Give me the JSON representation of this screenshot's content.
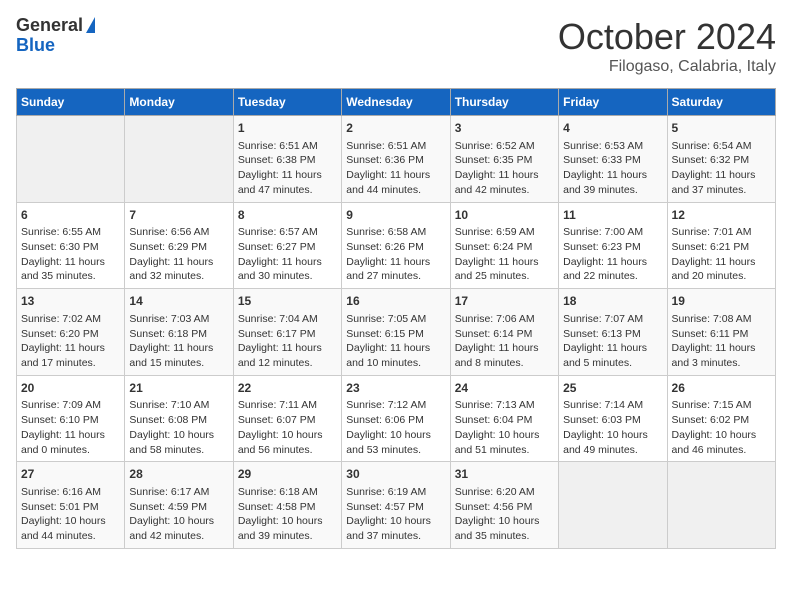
{
  "header": {
    "logo_general": "General",
    "logo_blue": "Blue",
    "title": "October 2024",
    "location": "Filogaso, Calabria, Italy"
  },
  "weekdays": [
    "Sunday",
    "Monday",
    "Tuesday",
    "Wednesday",
    "Thursday",
    "Friday",
    "Saturday"
  ],
  "weeks": [
    [
      {
        "day": "",
        "content": ""
      },
      {
        "day": "",
        "content": ""
      },
      {
        "day": "1",
        "content": "Sunrise: 6:51 AM\nSunset: 6:38 PM\nDaylight: 11 hours and 47 minutes."
      },
      {
        "day": "2",
        "content": "Sunrise: 6:51 AM\nSunset: 6:36 PM\nDaylight: 11 hours and 44 minutes."
      },
      {
        "day": "3",
        "content": "Sunrise: 6:52 AM\nSunset: 6:35 PM\nDaylight: 11 hours and 42 minutes."
      },
      {
        "day": "4",
        "content": "Sunrise: 6:53 AM\nSunset: 6:33 PM\nDaylight: 11 hours and 39 minutes."
      },
      {
        "day": "5",
        "content": "Sunrise: 6:54 AM\nSunset: 6:32 PM\nDaylight: 11 hours and 37 minutes."
      }
    ],
    [
      {
        "day": "6",
        "content": "Sunrise: 6:55 AM\nSunset: 6:30 PM\nDaylight: 11 hours and 35 minutes."
      },
      {
        "day": "7",
        "content": "Sunrise: 6:56 AM\nSunset: 6:29 PM\nDaylight: 11 hours and 32 minutes."
      },
      {
        "day": "8",
        "content": "Sunrise: 6:57 AM\nSunset: 6:27 PM\nDaylight: 11 hours and 30 minutes."
      },
      {
        "day": "9",
        "content": "Sunrise: 6:58 AM\nSunset: 6:26 PM\nDaylight: 11 hours and 27 minutes."
      },
      {
        "day": "10",
        "content": "Sunrise: 6:59 AM\nSunset: 6:24 PM\nDaylight: 11 hours and 25 minutes."
      },
      {
        "day": "11",
        "content": "Sunrise: 7:00 AM\nSunset: 6:23 PM\nDaylight: 11 hours and 22 minutes."
      },
      {
        "day": "12",
        "content": "Sunrise: 7:01 AM\nSunset: 6:21 PM\nDaylight: 11 hours and 20 minutes."
      }
    ],
    [
      {
        "day": "13",
        "content": "Sunrise: 7:02 AM\nSunset: 6:20 PM\nDaylight: 11 hours and 17 minutes."
      },
      {
        "day": "14",
        "content": "Sunrise: 7:03 AM\nSunset: 6:18 PM\nDaylight: 11 hours and 15 minutes."
      },
      {
        "day": "15",
        "content": "Sunrise: 7:04 AM\nSunset: 6:17 PM\nDaylight: 11 hours and 12 minutes."
      },
      {
        "day": "16",
        "content": "Sunrise: 7:05 AM\nSunset: 6:15 PM\nDaylight: 11 hours and 10 minutes."
      },
      {
        "day": "17",
        "content": "Sunrise: 7:06 AM\nSunset: 6:14 PM\nDaylight: 11 hours and 8 minutes."
      },
      {
        "day": "18",
        "content": "Sunrise: 7:07 AM\nSunset: 6:13 PM\nDaylight: 11 hours and 5 minutes."
      },
      {
        "day": "19",
        "content": "Sunrise: 7:08 AM\nSunset: 6:11 PM\nDaylight: 11 hours and 3 minutes."
      }
    ],
    [
      {
        "day": "20",
        "content": "Sunrise: 7:09 AM\nSunset: 6:10 PM\nDaylight: 11 hours and 0 minutes."
      },
      {
        "day": "21",
        "content": "Sunrise: 7:10 AM\nSunset: 6:08 PM\nDaylight: 10 hours and 58 minutes."
      },
      {
        "day": "22",
        "content": "Sunrise: 7:11 AM\nSunset: 6:07 PM\nDaylight: 10 hours and 56 minutes."
      },
      {
        "day": "23",
        "content": "Sunrise: 7:12 AM\nSunset: 6:06 PM\nDaylight: 10 hours and 53 minutes."
      },
      {
        "day": "24",
        "content": "Sunrise: 7:13 AM\nSunset: 6:04 PM\nDaylight: 10 hours and 51 minutes."
      },
      {
        "day": "25",
        "content": "Sunrise: 7:14 AM\nSunset: 6:03 PM\nDaylight: 10 hours and 49 minutes."
      },
      {
        "day": "26",
        "content": "Sunrise: 7:15 AM\nSunset: 6:02 PM\nDaylight: 10 hours and 46 minutes."
      }
    ],
    [
      {
        "day": "27",
        "content": "Sunrise: 6:16 AM\nSunset: 5:01 PM\nDaylight: 10 hours and 44 minutes."
      },
      {
        "day": "28",
        "content": "Sunrise: 6:17 AM\nSunset: 4:59 PM\nDaylight: 10 hours and 42 minutes."
      },
      {
        "day": "29",
        "content": "Sunrise: 6:18 AM\nSunset: 4:58 PM\nDaylight: 10 hours and 39 minutes."
      },
      {
        "day": "30",
        "content": "Sunrise: 6:19 AM\nSunset: 4:57 PM\nDaylight: 10 hours and 37 minutes."
      },
      {
        "day": "31",
        "content": "Sunrise: 6:20 AM\nSunset: 4:56 PM\nDaylight: 10 hours and 35 minutes."
      },
      {
        "day": "",
        "content": ""
      },
      {
        "day": "",
        "content": ""
      }
    ]
  ]
}
